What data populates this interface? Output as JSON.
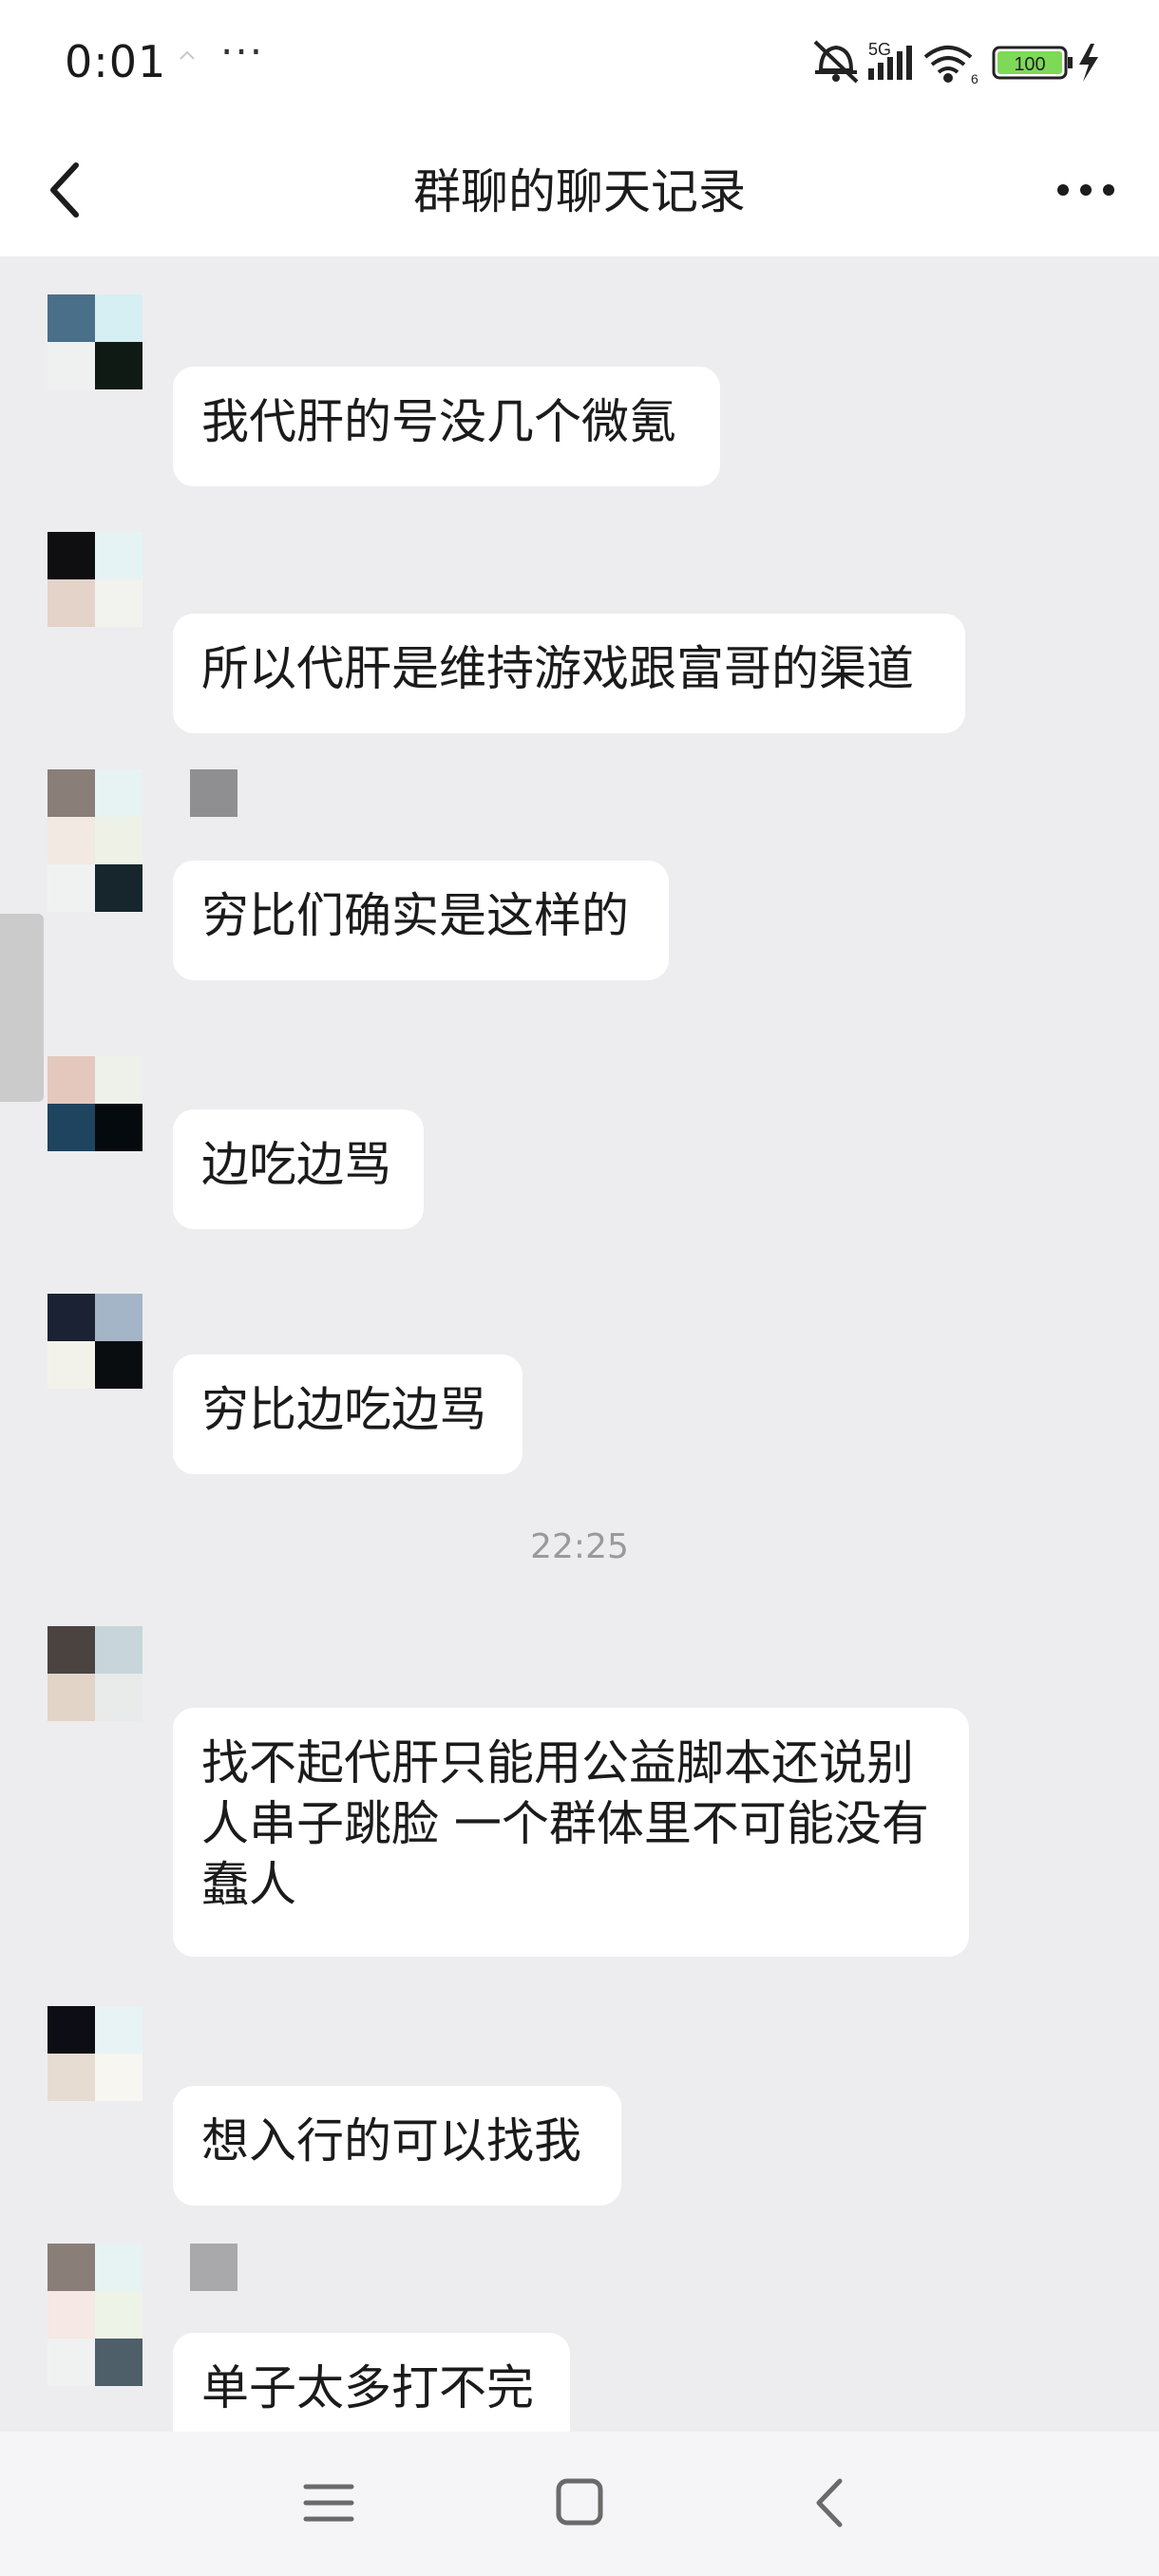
{
  "status_bar": {
    "time": "0:01",
    "dots": "···",
    "network": "5G",
    "battery": "100",
    "colors": {
      "battery_fill": "#7ed957"
    }
  },
  "nav": {
    "title": "群聊的聊天记录",
    "back_icon": "chevron-left-icon",
    "more_icon": "more-dots-icon"
  },
  "messages": [
    {
      "text": "我代肝的号没几个微氪"
    },
    {
      "text": "所以代肝是维持游戏跟富哥的渠道"
    },
    {
      "text": "穷比们确实是这样的"
    },
    {
      "text": "边吃边骂"
    },
    {
      "text": "穷比边吃边骂"
    },
    {
      "text": "找不起代肝只能用公益脚本还说别人串子跳脸 一个群体里不可能没有蠢人"
    },
    {
      "text": "想入行的可以找我"
    },
    {
      "text": "单子太多打不完"
    }
  ],
  "time_divider": "22:25",
  "sys_nav": {
    "menu_icon": "menu-icon",
    "home_icon": "home-square-icon",
    "back_icon": "back-triangle-icon"
  }
}
